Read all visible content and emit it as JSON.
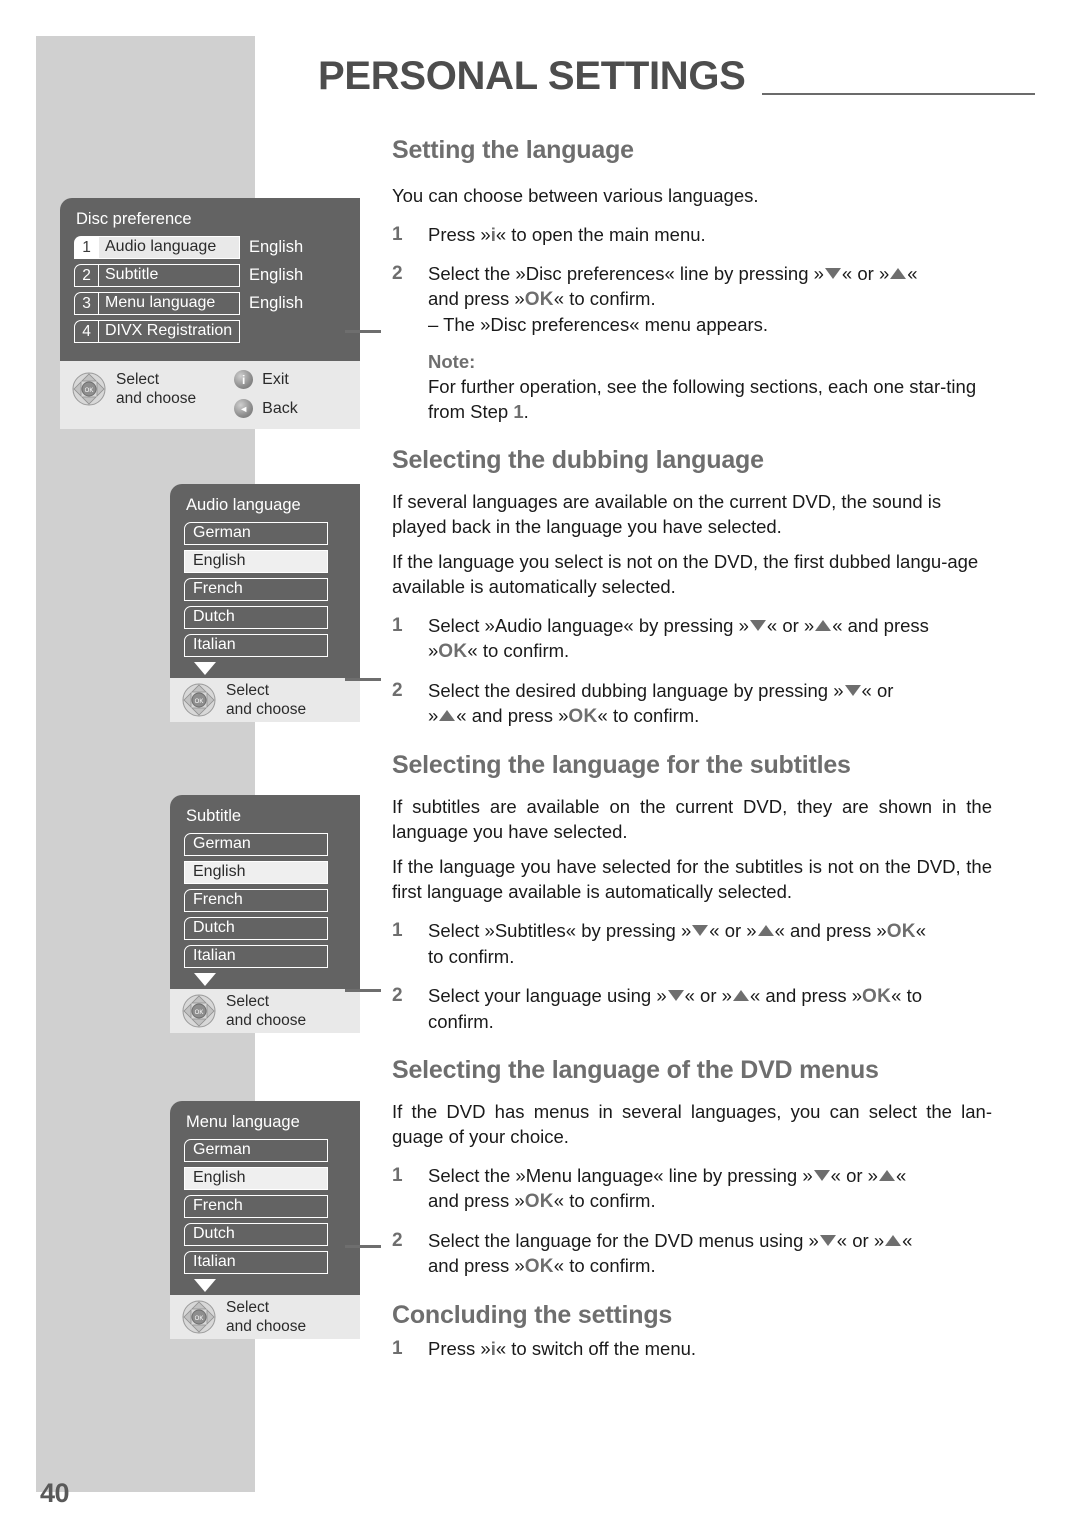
{
  "page": {
    "number": "40",
    "chapter_title": "PERSONAL SETTINGS"
  },
  "sections": {
    "setting_language": {
      "heading": "Setting the language",
      "intro": "You can choose between various languages.",
      "step1_num": "1",
      "step1_a": "Press »",
      "step1_key": "i",
      "step1_b": "« to open the main menu.",
      "step2_num": "2",
      "step2_a": "Select the »Disc preferences« line by pressing »",
      "step2_b": "« or »",
      "step2_c": "«",
      "step2_d": "and press »",
      "step2_ok": "OK",
      "step2_e": "« to confirm.",
      "step2_sub": "– The »Disc preferences« menu appears.",
      "note_label": "Note:",
      "note_a": "For further operation, see the following sections, each one star-ting from  Step ",
      "note_step": "1",
      "note_b": "."
    },
    "dubbing": {
      "heading": "Selecting the dubbing language",
      "para1": "If several languages are available on the current DVD, the sound is played back in the language you have selected.",
      "para2": "If the language you select is not on the DVD, the first dubbed langu-age available is automatically selected.",
      "step1_num": "1",
      "step1_a": "Select »Audio language« by pressing »",
      "step1_b": "« or »",
      "step1_c": "« and press",
      "step1_d": "»",
      "step1_ok": "OK",
      "step1_e": "« to confirm.",
      "step2_num": "2",
      "step2_a": "Select the desired dubbing language by pressing »",
      "step2_b": "« or",
      "step2_c": "»",
      "step2_d": "« and press »",
      "step2_ok": "OK",
      "step2_e": "« to confirm."
    },
    "subtitles": {
      "heading": "Selecting the language for the subtitles",
      "para1": "If subtitles are available on the current DVD, they are shown in the language you have selected.",
      "para2": "If the language you have selected for the subtitles is not on the DVD, the first language available is automatically selected.",
      "step1_num": "1",
      "step1_a": "Select »Subtitles« by pressing »",
      "step1_b": "« or »",
      "step1_c": "« and press »",
      "step1_ok": "OK",
      "step1_d": "«",
      "step1_e": "to confirm.",
      "step2_num": "2",
      "step2_a": "Select your language using »",
      "step2_b": "« or »",
      "step2_c": "« and press »",
      "step2_ok": "OK",
      "step2_d": "« to",
      "step2_e": "confirm."
    },
    "dvd_menus": {
      "heading": "Selecting the language of the DVD menus",
      "para1": "If the DVD has menus in several languages, you can select the lan-guage of your choice.",
      "step1_num": "1",
      "step1_a": "Select the »Menu language« line by pressing »",
      "step1_b": "« or »",
      "step1_c": "«",
      "step1_d": "and press »",
      "step1_ok": "OK",
      "step1_e": "« to confirm.",
      "step2_num": "2",
      "step2_a": "Select the language for the DVD menus using »",
      "step2_b": "« or »",
      "step2_c": "«",
      "step2_d": "and press »",
      "step2_ok": "OK",
      "step2_e": "« to confirm."
    },
    "concluding": {
      "heading": "Concluding the settings",
      "step1_num": "1",
      "step1_a": "Press »",
      "step1_key": "i",
      "step1_b": "« to switch off the menu."
    }
  },
  "osd": {
    "disc_preference": {
      "title": "Disc preference",
      "rows": [
        {
          "badge": "1",
          "label": "Audio language",
          "value": "English",
          "selected": true
        },
        {
          "badge": "2",
          "label": "Subtitle",
          "value": "English",
          "selected": false
        },
        {
          "badge": "3",
          "label": "Menu language",
          "value": "English",
          "selected": false
        },
        {
          "badge": "4",
          "label": "DIVX Registration",
          "value": "",
          "selected": false
        }
      ],
      "help_select": "Select",
      "help_choose": "and choose",
      "exit_label": "Exit",
      "exit_glyph": "i",
      "back_label": "Back",
      "back_glyph": "◄"
    },
    "audio_language": {
      "title": "Audio language",
      "items": [
        "German",
        "English",
        "French",
        "Dutch",
        "Italian"
      ],
      "selected": "English",
      "has_more": true,
      "help_select": "Select",
      "help_choose": "and choose"
    },
    "subtitle": {
      "title": "Subtitle",
      "items": [
        "German",
        "English",
        "French",
        "Dutch",
        "Italian"
      ],
      "selected": "English",
      "has_more": true,
      "help_select": "Select",
      "help_choose": "and choose"
    },
    "menu_language": {
      "title": "Menu language",
      "items": [
        "German",
        "English",
        "French",
        "Dutch",
        "Italian"
      ],
      "selected": "English",
      "has_more": true,
      "help_select": "Select",
      "help_choose": "and choose"
    }
  },
  "colors": {
    "osd_background": "#636363",
    "heading_gray": "#6e6e6e",
    "sidebar_gray": "#d0d0d0",
    "help_bar": "#e9e9e9"
  }
}
